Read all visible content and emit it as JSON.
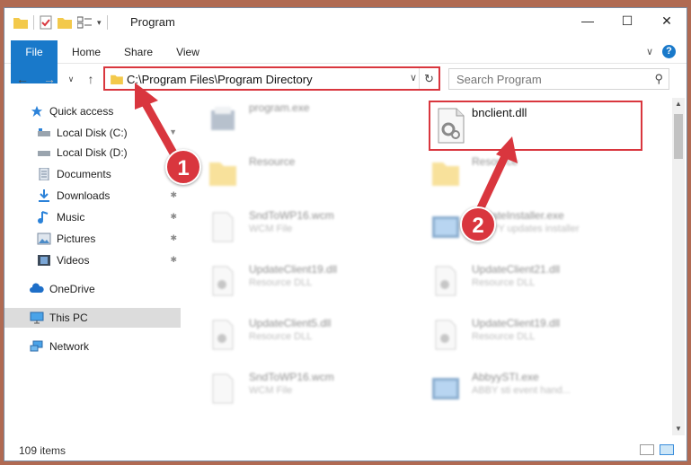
{
  "window": {
    "title": "Program",
    "minimize": "—",
    "maximize": "☐",
    "close": "✕"
  },
  "ribbon": {
    "tabs": [
      {
        "label": "File"
      },
      {
        "label": "Home"
      },
      {
        "label": "Share"
      },
      {
        "label": "View"
      }
    ],
    "help": "?",
    "expand": "∨"
  },
  "navigation": {
    "back": "←",
    "forward": "→",
    "recent": "∨",
    "up": "↑",
    "address": "C:\\Program Files\\Program Directory",
    "dropdown": "∨",
    "refresh": "↻",
    "search_placeholder": "Search Program",
    "search_icon": "⚲"
  },
  "sidebar": {
    "items": [
      {
        "label": "Quick access",
        "icon": "star-icon"
      },
      {
        "label": "Local Disk (C:)",
        "icon": "drive-icon"
      },
      {
        "label": "Local Disk (D:)",
        "icon": "drive-icon"
      },
      {
        "label": "Documents",
        "icon": "documents-icon"
      },
      {
        "label": "Downloads",
        "icon": "download-icon"
      },
      {
        "label": "Music",
        "icon": "music-icon"
      },
      {
        "label": "Pictures",
        "icon": "pictures-icon"
      },
      {
        "label": "Videos",
        "icon": "videos-icon"
      },
      {
        "label": "OneDrive",
        "icon": "cloud-icon"
      },
      {
        "label": "This PC",
        "icon": "computer-icon"
      },
      {
        "label": "Network",
        "icon": "network-icon"
      }
    ],
    "pin": "📌"
  },
  "files": [
    {
      "name": "program.exe",
      "type": ""
    },
    {
      "name": "bnclient.dll",
      "type": ""
    },
    {
      "name": "Resource",
      "type": ""
    },
    {
      "name": "Resource",
      "type": ""
    },
    {
      "name": "SndToWP16.wcm",
      "type": "WCM File"
    },
    {
      "name": "UpdateInstaller.exe",
      "type": "ABBYY updates installer"
    },
    {
      "name": "UpdateClient19.dll",
      "type": "Resource DLL"
    },
    {
      "name": "UpdateClient21.dll",
      "type": "Resource DLL"
    },
    {
      "name": "UpdateClient5.dll",
      "type": "Resource DLL"
    },
    {
      "name": "UpdateClient19.dll",
      "type": "Resource DLL"
    },
    {
      "name": "SndToWP16.wcm",
      "type": "WCM File"
    },
    {
      "name": "AbbyySTI.exe",
      "type": "ABBY sti event hand..."
    }
  ],
  "status": {
    "item_count": "109 items"
  },
  "annotations": {
    "step1": "1",
    "step2": "2"
  },
  "colors": {
    "accent": "#1979ca",
    "highlight": "#d9363e"
  }
}
